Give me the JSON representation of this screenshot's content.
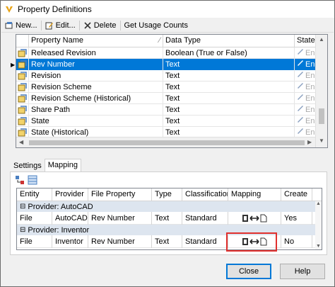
{
  "window": {
    "title": "Property Definitions"
  },
  "toolbar": {
    "new_label": "New...",
    "edit_label": "Edit...",
    "delete_label": "Delete",
    "usage_label": "Get Usage Counts"
  },
  "properties": {
    "columns": [
      "Property Name",
      "Data Type",
      "State"
    ],
    "rows": [
      {
        "name": "Released Revision",
        "type": "Boolean (True or False)",
        "state": "En",
        "selected": false
      },
      {
        "name": "Rev Number",
        "type": "Text",
        "state": "En",
        "selected": true
      },
      {
        "name": "Revision",
        "type": "Text",
        "state": "En",
        "selected": false
      },
      {
        "name": "Revision Scheme",
        "type": "Text",
        "state": "En",
        "selected": false
      },
      {
        "name": "Revision Scheme (Historical)",
        "type": "Text",
        "state": "En",
        "selected": false
      },
      {
        "name": "Share Path",
        "type": "Text",
        "state": "En",
        "selected": false
      },
      {
        "name": "State",
        "type": "Text",
        "state": "En",
        "selected": false
      },
      {
        "name": "State (Historical)",
        "type": "Text",
        "state": "En",
        "selected": false
      }
    ]
  },
  "tabs": {
    "settings": "Settings",
    "mapping": "Mapping"
  },
  "mapping": {
    "columns": [
      "Entity",
      "Provider",
      "File Property",
      "Type",
      "Classification",
      "Mapping",
      "Create"
    ],
    "groups": [
      {
        "label": "Provider: AutoCAD",
        "row": {
          "entity": "File",
          "provider": "AutoCAD",
          "file_property": "Rev Number",
          "type": "Text",
          "classification": "Standard",
          "create": "Yes"
        }
      },
      {
        "label": "Provider: Inventor",
        "row": {
          "entity": "File",
          "provider": "Inventor",
          "file_property": "Rev Number",
          "type": "Text",
          "classification": "Standard",
          "create": "No"
        }
      }
    ]
  },
  "buttons": {
    "close": "Close",
    "help": "Help"
  },
  "colors": {
    "selection": "#0078d7",
    "highlight": "#e0302e",
    "group_band": "#dde5ef"
  }
}
